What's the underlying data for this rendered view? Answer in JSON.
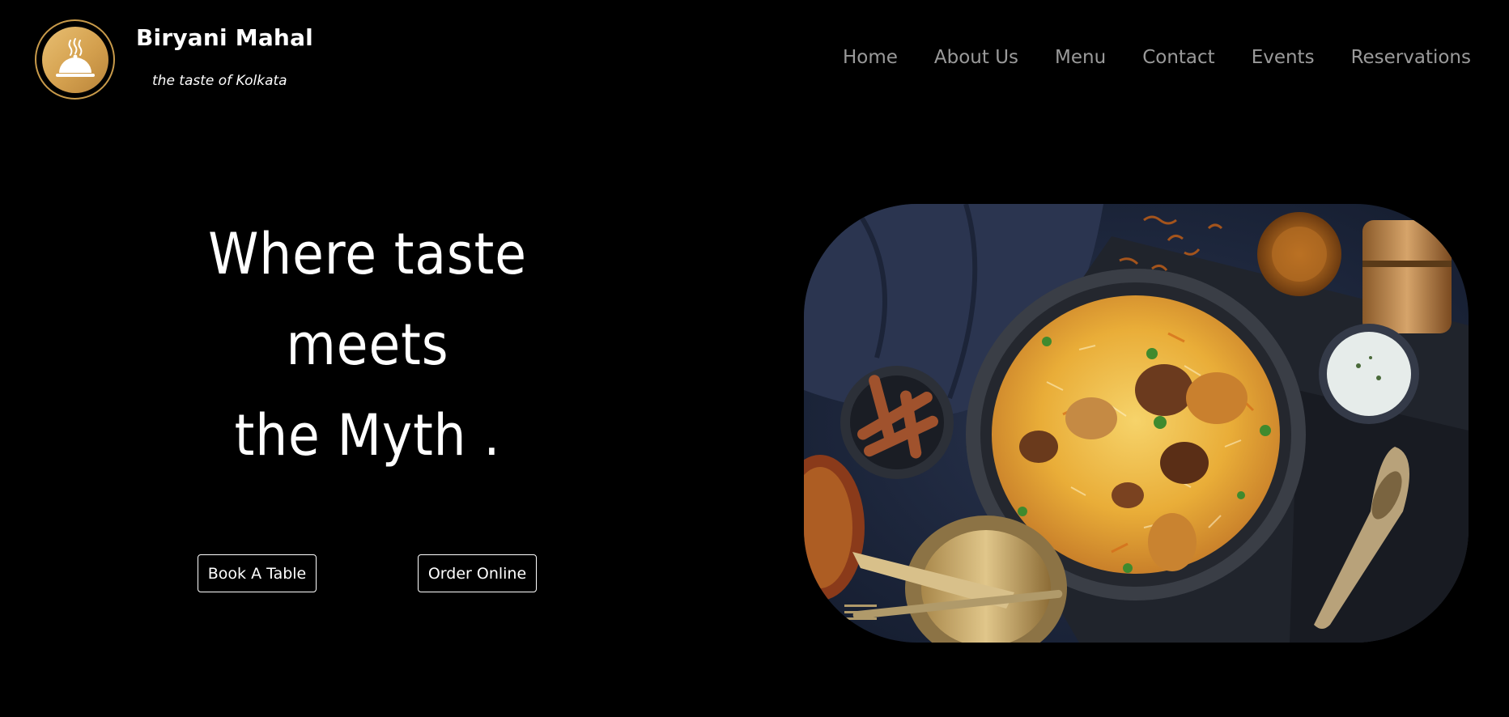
{
  "header": {
    "brand_name": "Biryani Mahal",
    "tagline": "the taste of Kolkata",
    "logo_icon": "cloche-icon",
    "nav": [
      {
        "label": "Home"
      },
      {
        "label": "About Us"
      },
      {
        "label": "Menu"
      },
      {
        "label": "Contact"
      },
      {
        "label": "Events"
      },
      {
        "label": "Reservations"
      }
    ]
  },
  "hero": {
    "heading_lines": [
      "Where taste",
      "meets",
      "the Myth ."
    ],
    "book_button_label": "Book A Table",
    "order_button_label": "Order Online",
    "image_subject": "biryani-dish-photo"
  },
  "colors": {
    "background": "#000000",
    "accent_gold": "#d4a04e",
    "nav_text": "#9a9a9a"
  }
}
